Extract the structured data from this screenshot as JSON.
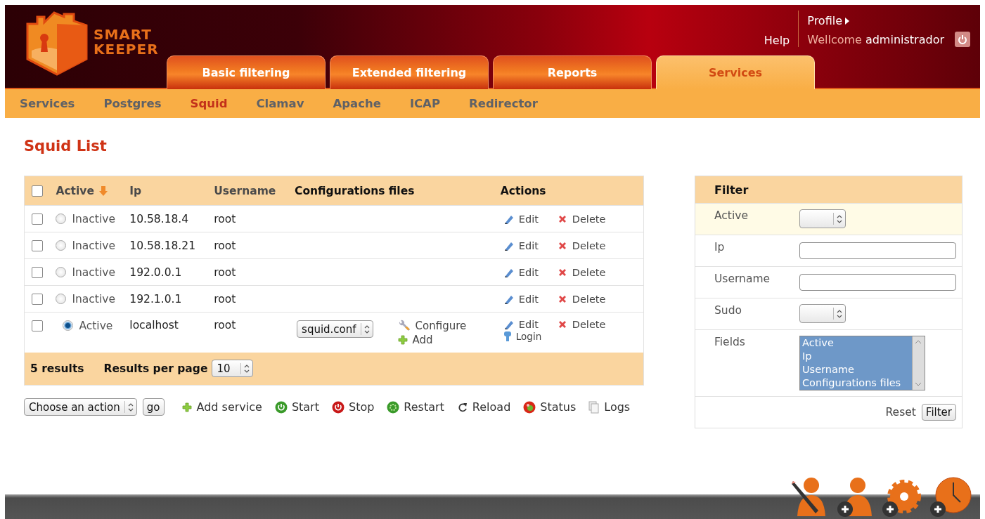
{
  "brand": {
    "line_1": "SMART",
    "line_2": "KEEPER"
  },
  "user_menu": {
    "profile": "Profile",
    "help": "Help",
    "greeting": "Wellcome",
    "user": "administrador"
  },
  "tabs": [
    {
      "label": "Basic filtering",
      "selected": false
    },
    {
      "label": "Extended filtering",
      "selected": false
    },
    {
      "label": "Reports",
      "selected": false
    },
    {
      "label": "Services",
      "selected": true
    }
  ],
  "subnav": [
    {
      "label": "Services",
      "selected": false
    },
    {
      "label": "Postgres",
      "selected": false
    },
    {
      "label": "Squid",
      "selected": true
    },
    {
      "label": "Clamav",
      "selected": false
    },
    {
      "label": "Apache",
      "selected": false
    },
    {
      "label": "ICAP",
      "selected": false
    },
    {
      "label": "Redirector",
      "selected": false
    }
  ],
  "page_title": "Squid List",
  "table": {
    "header_checked": false,
    "columns": [
      {
        "label": "Active",
        "sortable": true,
        "sorted": true
      },
      {
        "label": "Ip",
        "sortable": true,
        "sorted": false
      },
      {
        "label": "Username",
        "sortable": true,
        "sorted": false
      },
      {
        "label": "Configurations files",
        "sortable": false,
        "sorted": false
      },
      {
        "label": "Actions",
        "sortable": false,
        "sorted": false
      }
    ],
    "rows": [
      {
        "checked": false,
        "active": false,
        "status": "Inactive",
        "ip": "10.58.18.4",
        "username": "root",
        "edit": "Edit",
        "delete": "Delete"
      },
      {
        "checked": false,
        "active": false,
        "status": "Inactive",
        "ip": "10.58.18.21",
        "username": "root",
        "edit": "Edit",
        "delete": "Delete"
      },
      {
        "checked": false,
        "active": false,
        "status": "Inactive",
        "ip": "192.0.0.1",
        "username": "root",
        "edit": "Edit",
        "delete": "Delete"
      },
      {
        "checked": false,
        "active": false,
        "status": "Inactive",
        "ip": "192.1.0.1",
        "username": "root",
        "edit": "Edit",
        "delete": "Delete"
      },
      {
        "checked": false,
        "active": true,
        "status": "Active",
        "ip": "localhost",
        "username": "root",
        "config_file": "squid.conf",
        "configure": "Configure",
        "add": "Add",
        "edit": "Edit",
        "delete": "Delete",
        "login": "Login"
      }
    ],
    "result_count": "5 results",
    "per_page_label": "Results per page",
    "per_page": "10"
  },
  "bulk": {
    "select": "Choose an action",
    "go": "go",
    "actions": [
      {
        "kind": "add",
        "label": "Add service"
      },
      {
        "kind": "start",
        "label": "Start"
      },
      {
        "kind": "stop",
        "label": "Stop"
      },
      {
        "kind": "restart",
        "label": "Restart"
      },
      {
        "kind": "reload",
        "label": "Reload"
      },
      {
        "kind": "status",
        "label": "Status"
      },
      {
        "kind": "logs",
        "label": "Logs"
      }
    ]
  },
  "filter": {
    "title": "Filter",
    "fields": [
      {
        "label": "Active",
        "kind": "select",
        "highlighted": true
      },
      {
        "label": "Ip",
        "kind": "text",
        "highlighted": false
      },
      {
        "label": "Username",
        "kind": "text",
        "highlighted": false
      },
      {
        "label": "Sudo",
        "kind": "select",
        "highlighted": false
      },
      {
        "label": "Fields",
        "kind": "multiselect",
        "highlighted": false,
        "options": [
          {
            "label": "Active",
            "selected": true
          },
          {
            "label": "Ip",
            "selected": true
          },
          {
            "label": "Username",
            "selected": true
          },
          {
            "label": "Configurations files",
            "selected": true
          }
        ]
      }
    ],
    "reset": "Reset",
    "submit": "Filter"
  }
}
